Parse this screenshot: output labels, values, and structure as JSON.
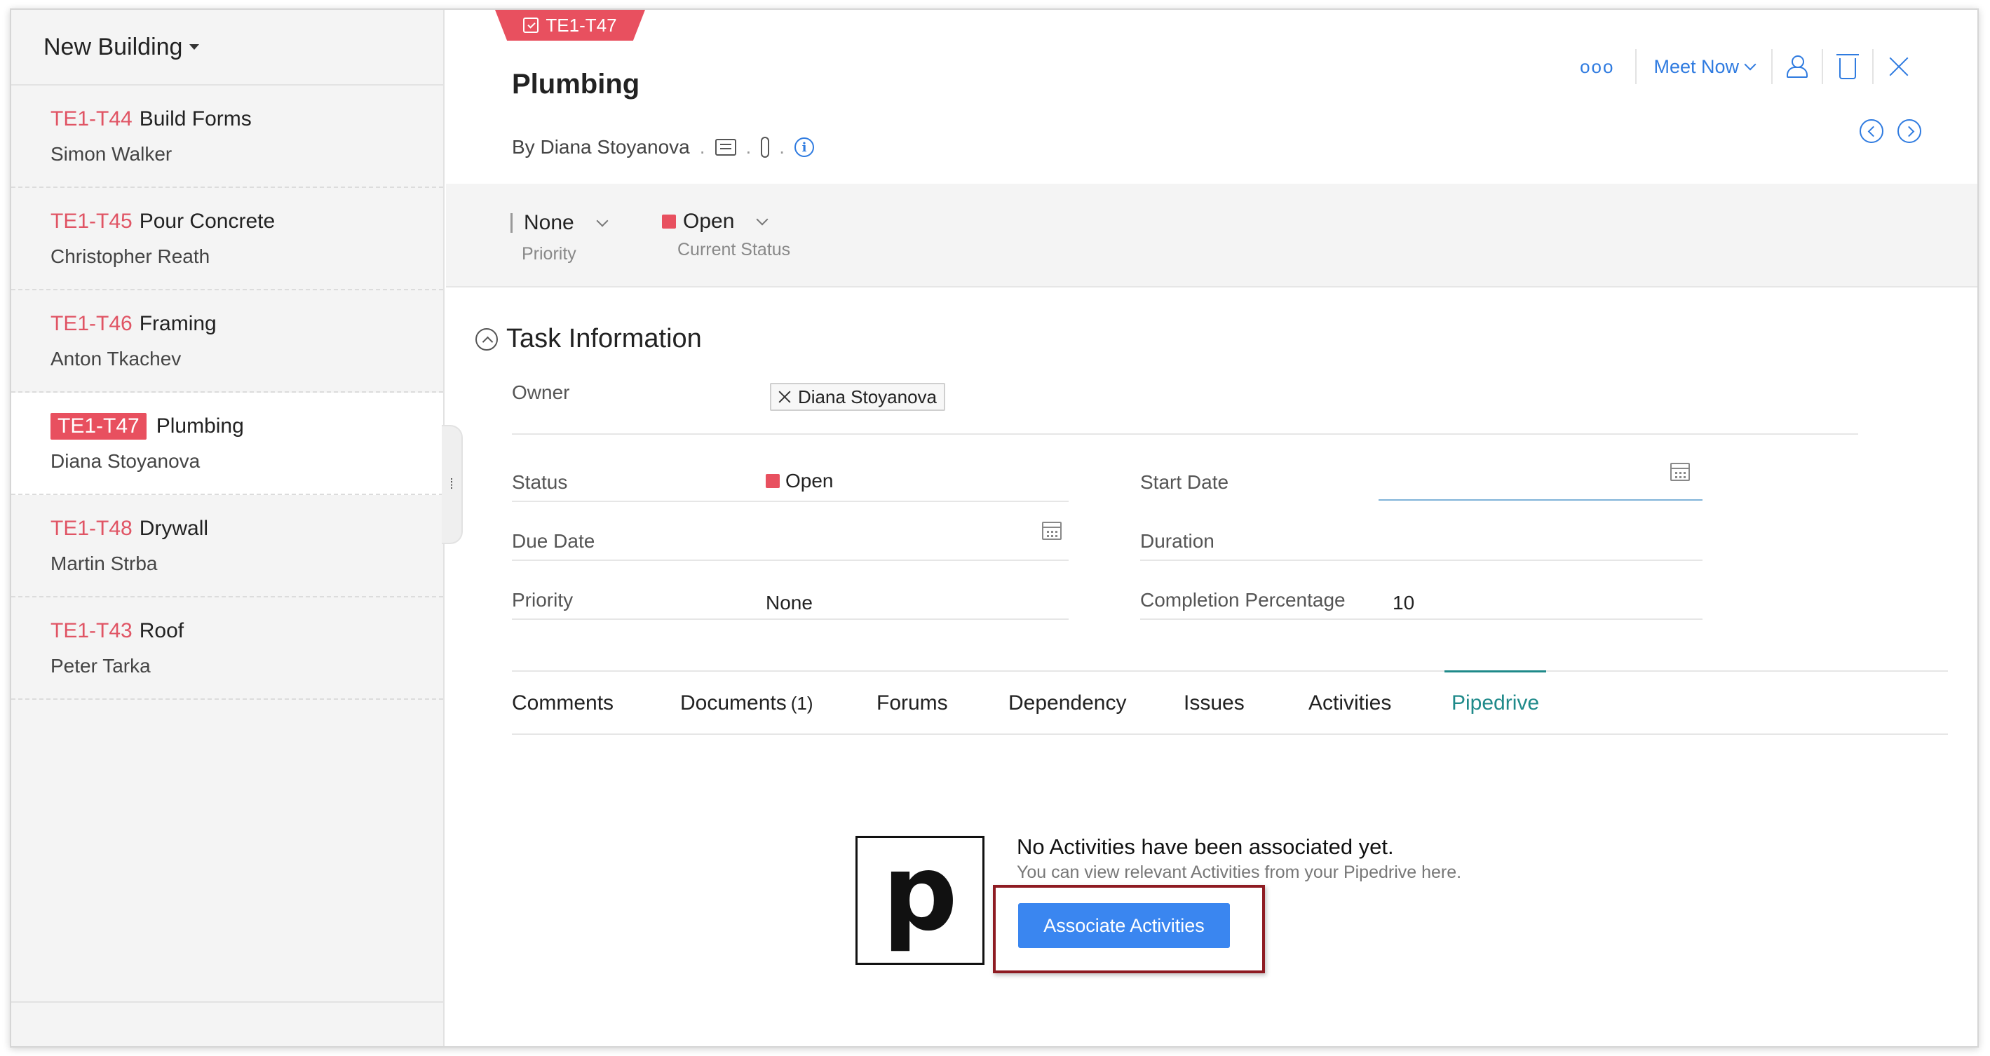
{
  "sidebar": {
    "project_name": "New Building",
    "tasks": [
      {
        "id": "TE1-T44",
        "title": "Build Forms",
        "owner": "Simon Walker"
      },
      {
        "id": "TE1-T45",
        "title": "Pour Concrete",
        "owner": "Christopher Reath"
      },
      {
        "id": "TE1-T46",
        "title": "Framing",
        "owner": "Anton Tkachev"
      },
      {
        "id": "TE1-T47",
        "title": "Plumbing",
        "owner": "Diana Stoyanova"
      },
      {
        "id": "TE1-T48",
        "title": "Drywall",
        "owner": "Martin Strba"
      },
      {
        "id": "TE1-T43",
        "title": "Roof",
        "owner": "Peter Tarka"
      }
    ]
  },
  "task": {
    "tag": "TE1-T47",
    "title": "Plumbing",
    "by_prefix": "By",
    "author": "Diana Stoyanova",
    "dot": "."
  },
  "topbar": {
    "more": "ooo",
    "meet_now": "Meet Now"
  },
  "status_band": {
    "priority_value": "None",
    "priority_label": "Priority",
    "status_value": "Open",
    "status_label": "Current Status"
  },
  "task_info": {
    "section_title": "Task Information",
    "owner_label": "Owner",
    "owner_value": "Diana Stoyanova",
    "status_label": "Status",
    "status_value": "Open",
    "start_date_label": "Start Date",
    "start_date_value": "",
    "due_date_label": "Due Date",
    "due_date_value": "",
    "duration_label": "Duration",
    "duration_value": "",
    "priority_label": "Priority",
    "priority_value": "None",
    "completion_label": "Completion Percentage",
    "completion_value": "10"
  },
  "tabs": [
    {
      "label": "Comments"
    },
    {
      "label": "Documents",
      "count": "(1)"
    },
    {
      "label": "Forums"
    },
    {
      "label": "Dependency"
    },
    {
      "label": "Issues"
    },
    {
      "label": "Activities"
    },
    {
      "label": "Pipedrive",
      "active": true
    }
  ],
  "pipedrive": {
    "logo_letter": "p",
    "empty_title": "No Activities have been associated yet.",
    "empty_subtitle": "You can view relevant Activities from your Pipedrive here.",
    "button_label": "Associate Activities"
  },
  "colors": {
    "accent_red": "#e8505f",
    "link_blue": "#2f7be0",
    "active_tab_teal": "#1f8a8a",
    "button_blue": "#3a86f0",
    "highlight_border": "#8e1b22"
  }
}
